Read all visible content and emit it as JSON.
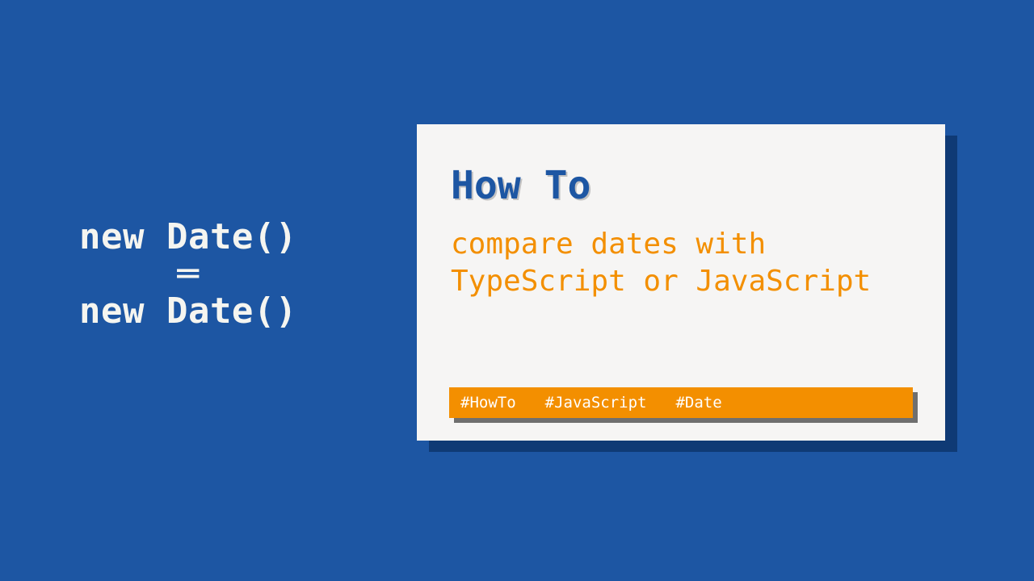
{
  "code": {
    "line1": "new Date()",
    "eq": "═",
    "line2": "new Date()"
  },
  "card": {
    "heading": "How To",
    "subtitle": "compare dates with TypeScript or JavaScript"
  },
  "tags": {
    "t1": "#HowTo",
    "t2": "#JavaScript",
    "t3": "#Date"
  },
  "colors": {
    "bg": "#1d56a3",
    "card_bg": "#f6f5f4",
    "card_shadow": "#0f3a75",
    "accent": "#f38f00",
    "tag_shadow": "#6f6f6f",
    "text_light": "#f5f5f0"
  }
}
